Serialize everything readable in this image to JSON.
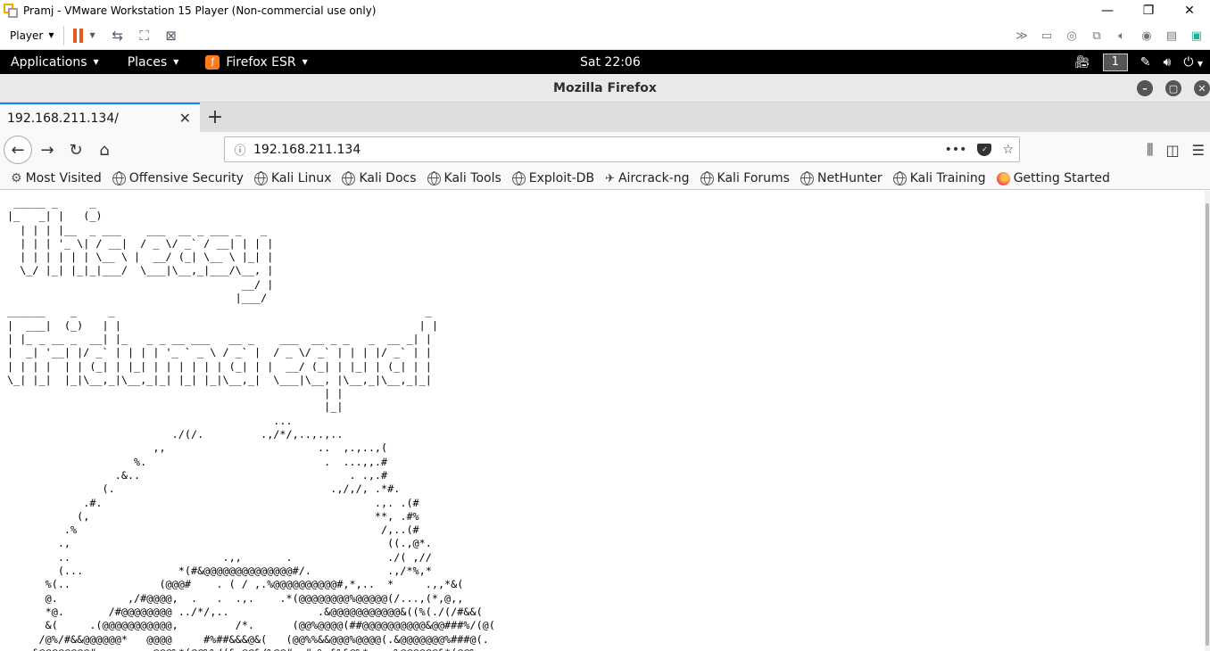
{
  "vmware": {
    "title": "Pramj - VMware Workstation 15 Player (Non-commercial use only)",
    "player_menu": "Player",
    "controls": {
      "minimize": "—",
      "restore": "❐",
      "close": "✕"
    }
  },
  "kali_panel": {
    "applications": "Applications",
    "places": "Places",
    "firefox": "Firefox ESR",
    "clock": "Sat 22:06",
    "workspace": "1"
  },
  "firefox": {
    "window_title": "Mozilla Firefox",
    "tab_title": "192.168.211.134/",
    "url": "192.168.211.134",
    "url_menu": "•••",
    "bookmarks": [
      "Most Visited",
      "Offensive Security",
      "Kali Linux",
      "Kali Docs",
      "Kali Tools",
      "Exploit-DB",
      "Aircrack-ng",
      "Kali Forums",
      "NetHunter",
      "Kali Training",
      "Getting Started"
    ]
  },
  "page": {
    "ascii_art": " _____ _     _\n|_   _| |   (_)\n  | | | |__  _ ___    ___  __ _ ___ _   _\n  | | | '_ \\| / __|  / _ \\/ _` / __| | | |\n  | | | | | | \\__ \\ |  __/ (_| \\__ \\ |_| |\n  \\_/ |_| |_|_|___/  \\___|\\__,_|___/\\__, |\n                                     __/ |\n                                    |___/\n______    _     _                                                 _\n|  ___|  (_)   | |                                               | |\n| |_ _ __ _  __| |_   _ _ __ ___   __ _    ___  __ _ _   _  __ _| |\n|  _| '__| |/ _` | | | | '_ ` _ \\ / _` |  / _ \\/ _` | | | |/ _` | |\n| | | |  | | (_| | |_| | | | | | | (_| | |  __/ (_| | |_| | (_| | |\n\\_| |_|  |_|\\__,_|\\__,_|_| |_| |_|\\__,_|  \\___|\\__, |\\__,_|\\__,_|_|\n                                                  | |\n                                                  |_|\n                                          ...\n                          ./(/.         .,/*/,..,.,..\n                       ,,                        ..  ,.,..,(\n                    %.                            .  ...,,.#\n                 .&..                                 . .,.#\n               (.                                  .,/,/, .*#.\n            .#.                                           .,. .(#\n           (,                                             **, .#%\n         .%                                                /,..(#\n        .,                                                  ((.,@*.\n        ..                        .,,       .               ./( ,//\n        (...               *(#&@@@@@@@@@@@@@@#/.            .,/*%,*\n      %(..              (@@@#    . ( / ,.%@@@@@@@@@@#,*,..  *     .,,*&(\n      @.           ,/#@@@@,  .   .  .,.    .*(@@@@@@@@%@@@@@(/...,(*,@,,\n      *@.       /#@@@@@@@@ ../*/,..              .&@@@@@@@@@@@&((%(./(/#&&(\n      &(     .(@@@@@@@@@@@,         /*.      (@@%@@@@(##@@@@@@@@@@&@@###%/(@(\n     /@%/#&&@@@@@@*   @@@@     #%##&&&@&(   (@@%%&&@@@%@@@@(.&@@@@@@@%###@(.\n   .&@@@@@@@@#.       .@@@%*(@@%%/(&.@@&/%@@#..#.%.&%&@%*.  .%@@@@@@&*(@@%"
  },
  "colors": {
    "tab_accent": "#0a84ff",
    "pause": "#e8581c",
    "kali_panel_bg": "#000000"
  },
  "icons": {
    "vm_toolbar": [
      "pause-icon",
      "send-ctrl-alt-del-icon",
      "full-screen-icon",
      "unity-icon"
    ],
    "vm_tray": [
      "chevron-icon",
      "hard-disk-icon",
      "cd-icon",
      "network-icon",
      "sound-icon",
      "usb-icon",
      "printer-icon",
      "message-icon"
    ]
  }
}
